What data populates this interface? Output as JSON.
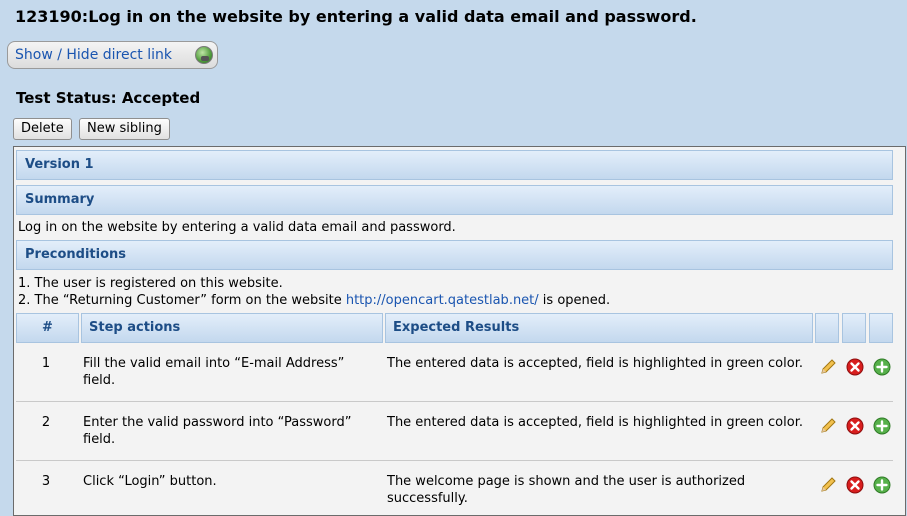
{
  "title": "123190:Log in on the website by entering a valid data email and password.",
  "direct_link_label": "Show / Hide direct link",
  "test_status": "Test Status: Accepted",
  "buttons": {
    "delete": "Delete",
    "new_sibling": "New sibling"
  },
  "version": "Version 1",
  "summary": {
    "heading": "Summary",
    "text": "Log in on the website by entering a valid data email and password."
  },
  "preconditions": {
    "heading": "Preconditions",
    "line1": "1. The user is registered on this website.",
    "line2_prefix": "2. The “Returning Customer” form on  the website ",
    "line2_link": "http://opencart.qatestlab.net/",
    "line2_suffix": " is opened."
  },
  "steps_table": {
    "headers": {
      "num": "#",
      "actions": "Step actions",
      "expected": "Expected Results"
    },
    "rows": [
      {
        "num": "1",
        "action": "Fill the valid email into “E-mail Address” field.",
        "expected": "The entered data is accepted, field is highlighted in green color."
      },
      {
        "num": "2",
        "action": "Enter the valid password into “Password” field.",
        "expected": "The entered data is accepted, field is highlighted in green color."
      },
      {
        "num": "3",
        "action": "Click “Login” button.",
        "expected": "The welcome page is shown and the user is authorized successfully."
      }
    ]
  },
  "icons": [
    "pencil-edit-icon",
    "delete-x-icon",
    "add-plus-icon"
  ]
}
